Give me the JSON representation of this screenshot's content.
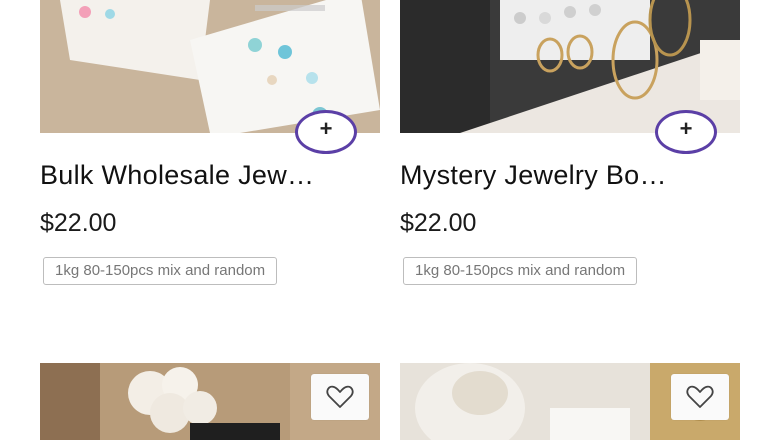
{
  "products": [
    {
      "title": "Bulk Wholesale Jew…",
      "price": "$22.00",
      "tag": "1kg 80-150pcs mix and random",
      "add_label": "+"
    },
    {
      "title": "Mystery Jewelry Bo…",
      "price": "$22.00",
      "tag": "1kg 80-150pcs mix and random",
      "add_label": "+"
    }
  ],
  "icons": {
    "add": "plus-icon",
    "favorite": "heart-icon"
  },
  "colors": {
    "add_button_ring": "#5b3fa6",
    "tag_border": "#bdbdbd",
    "text": "#111111"
  }
}
